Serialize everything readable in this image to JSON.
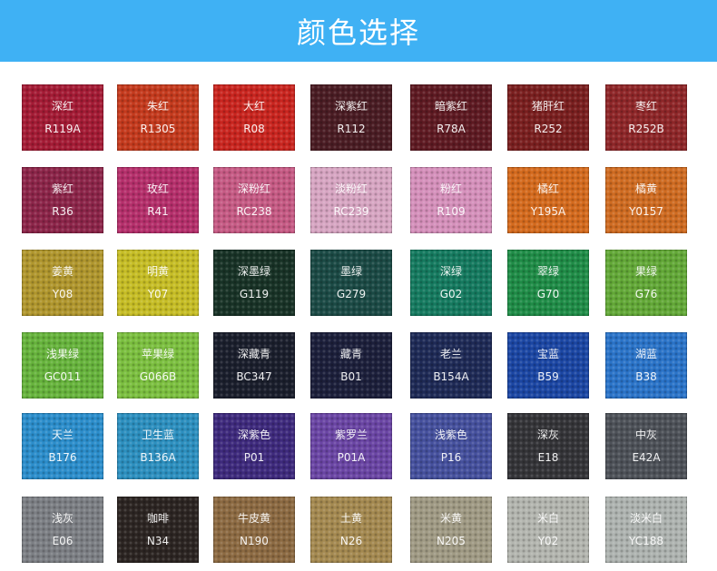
{
  "header": {
    "title": "颜色选择"
  },
  "swatches": [
    {
      "name": "深红",
      "code": "R119A",
      "color": "#a41b35"
    },
    {
      "name": "朱红",
      "code": "R1305",
      "color": "#c43a1d"
    },
    {
      "name": "大红",
      "code": "R08",
      "color": "#c9251f"
    },
    {
      "name": "深紫红",
      "code": "R112",
      "color": "#4a1c23"
    },
    {
      "name": "暗紫红",
      "code": "R78A",
      "color": "#5e1a22"
    },
    {
      "name": "猪肝红",
      "code": "R252",
      "color": "#7a1f1f"
    },
    {
      "name": "枣红",
      "code": "R252B",
      "color": "#8e2628"
    },
    {
      "name": "紫红",
      "code": "R36",
      "color": "#8c2549"
    },
    {
      "name": "玫红",
      "code": "R41",
      "color": "#b52f6b"
    },
    {
      "name": "深粉红",
      "code": "RC238",
      "color": "#c65a84"
    },
    {
      "name": "淡粉红",
      "code": "RC239",
      "color": "#d7a5c2"
    },
    {
      "name": "粉红",
      "code": "R109",
      "color": "#d590bb"
    },
    {
      "name": "橘红",
      "code": "Y195A",
      "color": "#d46a1d"
    },
    {
      "name": "橘黄",
      "code": "Y0157",
      "color": "#cf6b21"
    },
    {
      "name": "姜黄",
      "code": "Y08",
      "color": "#b0962d"
    },
    {
      "name": "明黄",
      "code": "Y07",
      "color": "#c6bd25"
    },
    {
      "name": "深墨绿",
      "code": "G119",
      "color": "#183226"
    },
    {
      "name": "墨绿",
      "code": "G279",
      "color": "#1b4a45"
    },
    {
      "name": "深绿",
      "code": "G02",
      "color": "#157a5f"
    },
    {
      "name": "翠绿",
      "code": "G70",
      "color": "#1f8c47"
    },
    {
      "name": "果绿",
      "code": "G76",
      "color": "#62a837"
    },
    {
      "name": "浅果绿",
      "code": "GC011",
      "color": "#66b33c"
    },
    {
      "name": "苹果绿",
      "code": "G066B",
      "color": "#7bbf3f"
    },
    {
      "name": "深藏青",
      "code": "BC347",
      "color": "#1a1e2c"
    },
    {
      "name": "藏青",
      "code": "B01",
      "color": "#1c1f3b"
    },
    {
      "name": "老兰",
      "code": "B154A",
      "color": "#1e2a56"
    },
    {
      "name": "宝蓝",
      "code": "B59",
      "color": "#1b46a3"
    },
    {
      "name": "湖蓝",
      "code": "B38",
      "color": "#2a73c8"
    },
    {
      "name": "天兰",
      "code": "B176",
      "color": "#2b8dcb"
    },
    {
      "name": "卫生蓝",
      "code": "B136A",
      "color": "#2c8fbf"
    },
    {
      "name": "深紫色",
      "code": "P01",
      "color": "#3e2a7d"
    },
    {
      "name": "紫罗兰",
      "code": "P01A",
      "color": "#6a45a4"
    },
    {
      "name": "浅紫色",
      "code": "P16",
      "color": "#45509d"
    },
    {
      "name": "深灰",
      "code": "E18",
      "color": "#343438"
    },
    {
      "name": "中灰",
      "code": "E42A",
      "color": "#4d5158"
    },
    {
      "name": "浅灰",
      "code": "E06",
      "color": "#7c7f84"
    },
    {
      "name": "咖啡",
      "code": "N34",
      "color": "#2c2522"
    },
    {
      "name": "牛皮黄",
      "code": "N190",
      "color": "#8c6a42"
    },
    {
      "name": "土黄",
      "code": "N26",
      "color": "#a48950"
    },
    {
      "name": "米黄",
      "code": "N205",
      "color": "#a09a84"
    },
    {
      "name": "米白",
      "code": "Y02",
      "color": "#b3b5af"
    },
    {
      "name": "淡米白",
      "code": "YC188",
      "color": "#aeb3b0"
    }
  ]
}
